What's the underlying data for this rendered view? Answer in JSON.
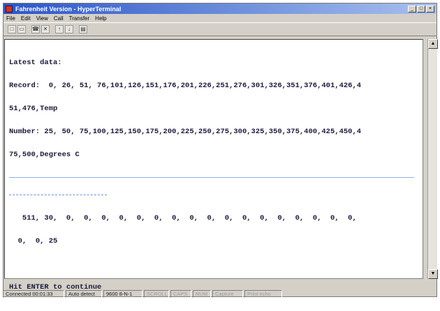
{
  "window": {
    "title": "Fahrenheit Version - HyperTerminal",
    "controls": {
      "minimize": "_",
      "maximize": "□",
      "close": "×"
    }
  },
  "menu": {
    "items": [
      "File",
      "Edit",
      "View",
      "Call",
      "Transfer",
      "Help"
    ]
  },
  "toolbar": {
    "icons": [
      "new-icon",
      "open-icon",
      "phone-icon",
      "disconnect-icon",
      "send-icon",
      "receive-icon",
      "properties-icon"
    ]
  },
  "terminal": {
    "line1": "Latest data:",
    "line2": "Record:  0, 26, 51, 76,101,126,151,176,201,226,251,276,301,326,351,376,401,426,4",
    "line3": "51,476,Temp",
    "line4": "Number: 25, 50, 75,100,125,150,175,200,225,250,275,300,325,350,375,400,425,450,4",
    "line5": "75,500,Degrees C",
    "line6": "   511, 30,  0,  0,  0,  0,  0,  0,  0,  0,  0,  0,  0,  0,  0,  0,  0,  0,  0,",
    "line7": "  0,  0, 25",
    "line8": "Hit ENTER to continue"
  },
  "status": {
    "connected": "Connected 00:01:33",
    "terminal": "Auto detect",
    "baud": "9600 8-N-1",
    "scroll": "SCROLL",
    "caps": "CAPS",
    "num": "NUM",
    "capture": "Capture",
    "print_echo": "Print echo"
  }
}
